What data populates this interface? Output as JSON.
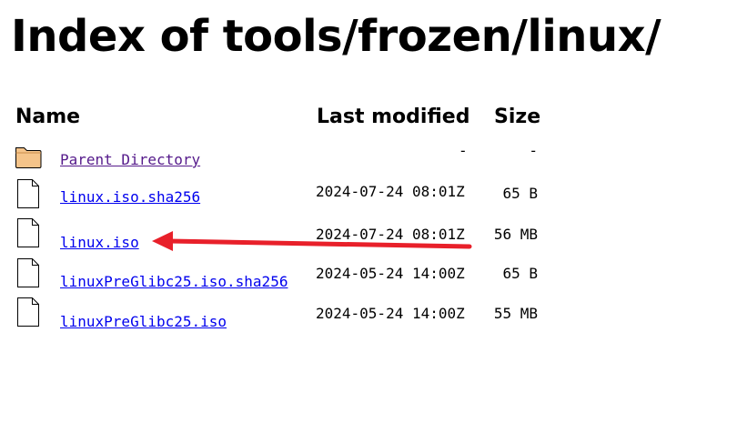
{
  "page": {
    "title": "Index of tools/frozen/linux/"
  },
  "columns": {
    "name": "Name",
    "last_modified": "Last modified",
    "size": "Size"
  },
  "entries": [
    {
      "name": "Parent Directory",
      "last_modified": "-",
      "size": "-",
      "icon": "folder-icon"
    },
    {
      "name": "linux.iso.sha256",
      "last_modified": "2024-07-24 08:01Z",
      "size": "65 B",
      "icon": "file-icon"
    },
    {
      "name": "linux.iso",
      "last_modified": "2024-07-24 08:01Z",
      "size": "56 MB",
      "icon": "file-icon"
    },
    {
      "name": "linuxPreGlibc25.iso.sha256",
      "last_modified": "2024-05-24 14:00Z",
      "size": "65 B",
      "icon": "file-icon"
    },
    {
      "name": "linuxPreGlibc25.iso",
      "last_modified": "2024-05-24 14:00Z",
      "size": "55 MB",
      "icon": "file-icon"
    }
  ],
  "annotation": {
    "arrow_color": "#e8202a",
    "points_to": "linux.iso"
  },
  "colors": {
    "link": "#0000ee",
    "visited_link": "#551a8b",
    "folder_fill": "#f5c48a",
    "folder_stroke": "#000000"
  }
}
